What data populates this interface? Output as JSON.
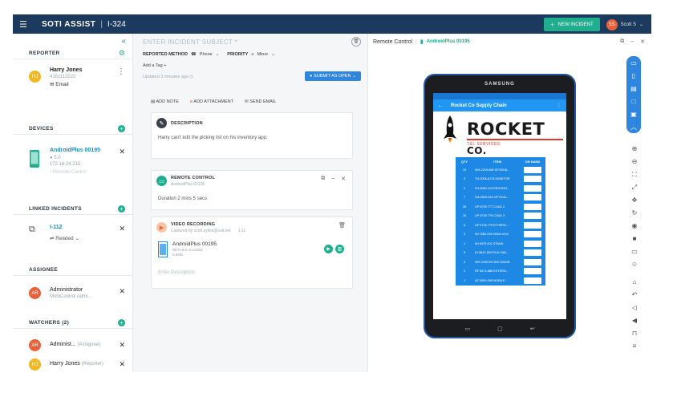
{
  "topbar": {
    "brand": "SOTI ASSIST",
    "separator": "|",
    "incident_id": "I-324",
    "new_incident": "NEW INCIDENT",
    "user_initials": "SS",
    "user_name": "Scott S"
  },
  "left": {
    "reporter": {
      "title": "REPORTER",
      "initials": "HJ",
      "name": "Harry Jones",
      "phone": "4161112222",
      "contact": "Email"
    },
    "devices": {
      "title": "DEVICES",
      "name": "AndroidPlus 00195",
      "os": "5.0",
      "ip": "172.16.24.215",
      "status": "Remote Control"
    },
    "linked": {
      "title": "LINKED INCIDENTS",
      "id": "I-112",
      "relation": "Related"
    },
    "assignee": {
      "title": "ASSIGNEE",
      "initials": "AR",
      "name": "Administrator",
      "sub": "MobiControl Admi..."
    },
    "watchers": {
      "title": "WATCHERS (2)",
      "items": [
        {
          "initials": "AR",
          "name": "Administ...",
          "role": "(Assignee)"
        },
        {
          "initials": "HJ",
          "name": "Harry Jones",
          "role": "(Reporter)"
        }
      ]
    }
  },
  "middle": {
    "subject_placeholder": "ENTER INCIDENT SUBJECT *",
    "reported_method_label": "REPORTED METHOD",
    "reported_method_value": "Phone",
    "priority_label": "PRIORITY",
    "priority_value": "Minor",
    "add_tag": "Add a Tag",
    "updated": "Updated 3 minutes ago",
    "submit": "SUBMIT AS OPEN",
    "actions": [
      "ADD NOTE",
      "ADD ATTACHMENT",
      "SEND EMAIL"
    ],
    "description": {
      "title": "DESCRIPTION",
      "text": "Harry can't edit the picking list on his inventory app."
    },
    "remote": {
      "title": "REMOTE CONTROL",
      "sub": "AndroidPlus 00195",
      "text": "Duration 2 mins 5 secs"
    },
    "video": {
      "title": "VIDEO RECORDING",
      "sub": "Captured by scott.sykes@soti.net",
      "time": "1:11",
      "device": "AndroidPlus 00195",
      "details_label": "DETAILS",
      "details_value": "recorded",
      "size": "6.5MB",
      "description_placeholder": "Enter Description"
    }
  },
  "right": {
    "title": "Remote Control",
    "device": "AndroidPlus 00195",
    "tablet": {
      "brand": "SAMSUNG",
      "app_title": "Rocket Co Supply Chain",
      "logo_main": "ROCKET",
      "logo_co": "CO.",
      "logo_sub": "T&L SERVICES",
      "columns": [
        "QTY",
        "ITEM",
        "ON HAND"
      ],
      "rows": [
        {
          "qty": "15",
          "item": "WH-2219-666 KEYBOA..."
        },
        {
          "qty": "3",
          "item": "TH-2006-6178 MONITOR"
        },
        {
          "qty": "2",
          "item": "FH-5082-115 ERGONO..."
        },
        {
          "qty": "7",
          "item": "LM-0829-034 OPTICAL..."
        },
        {
          "qty": "25",
          "item": "UP 6739 777 COAX 2"
        },
        {
          "qty": "15",
          "item": "UP 6739 778 COAX 3"
        },
        {
          "qty": "6",
          "item": "UP 6726 775 ETHERN..."
        },
        {
          "qty": "4",
          "item": "WI 7582-006 HDMI-VGA"
        },
        {
          "qty": "1",
          "item": "WI 8475-001 STAND"
        },
        {
          "qty": "9",
          "item": "IO 8642-553 RCA CAB..."
        },
        {
          "qty": "3",
          "item": "WH 2339-99 HDD 500GB"
        },
        {
          "qty": "1",
          "item": "RF 8474-888 EXTERN..."
        },
        {
          "qty": "1",
          "item": "AZ 6090-068 MOBILE..."
        }
      ]
    }
  }
}
